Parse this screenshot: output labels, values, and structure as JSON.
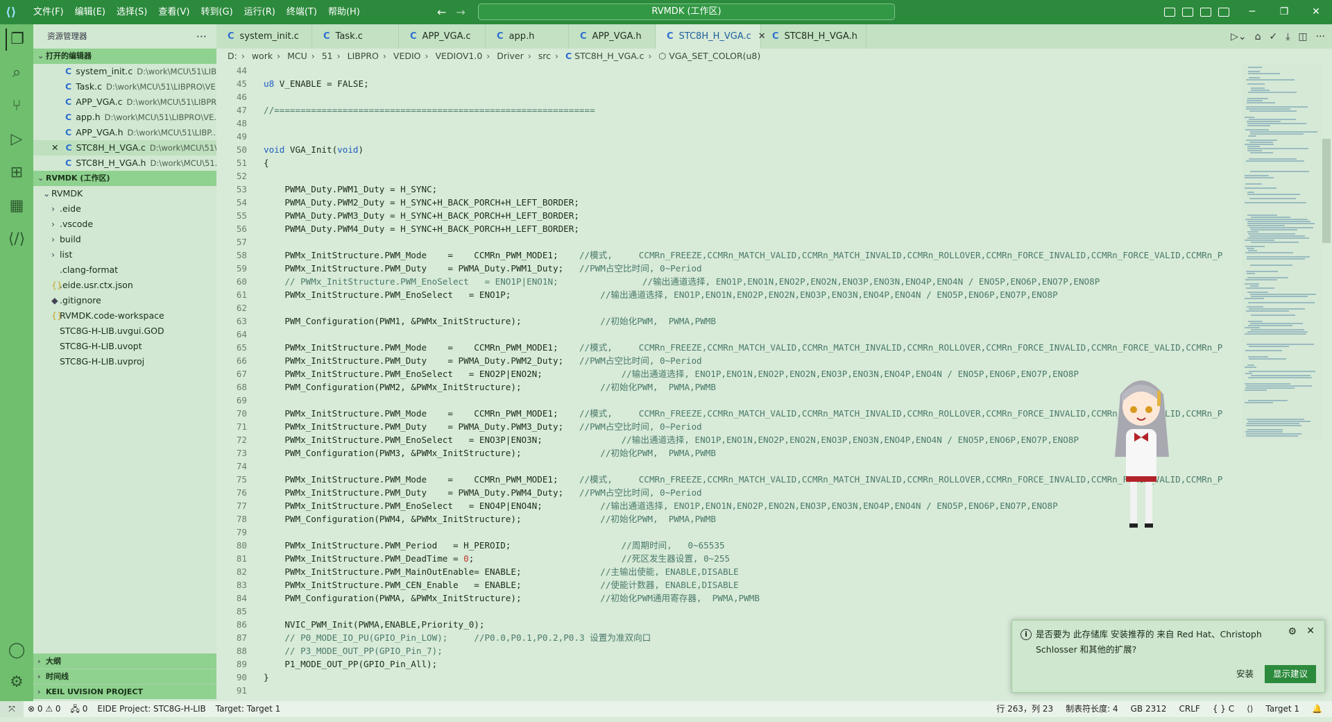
{
  "window": {
    "title": "RVMDK (工作区)"
  },
  "menu": [
    "文件(F)",
    "编辑(E)",
    "选择(S)",
    "查看(V)",
    "转到(G)",
    "运行(R)",
    "终端(T)",
    "帮助(H)"
  ],
  "sidebar": {
    "title": "资源管理器",
    "more": "···",
    "open_editors_title": "打开的编辑器",
    "open_editors": [
      {
        "name": "system_init.c",
        "path": "D:\\work\\MCU\\51\\LIB..."
      },
      {
        "name": "Task.c",
        "path": "D:\\work\\MCU\\51\\LIBPRO\\VE..."
      },
      {
        "name": "APP_VGA.c",
        "path": "D:\\work\\MCU\\51\\LIBPR..."
      },
      {
        "name": "app.h",
        "path": "D:\\work\\MCU\\51\\LIBPRO\\VE..."
      },
      {
        "name": "APP_VGA.h",
        "path": "D:\\work\\MCU\\51\\LIBP..."
      },
      {
        "name": "STC8H_H_VGA.c",
        "path": "D:\\work\\MCU\\51\\..."
      },
      {
        "name": "STC8H_H_VGA.h",
        "path": "D:\\work\\MCU\\51..."
      }
    ],
    "workspace_title": "RVMDK (工作区)",
    "root": "RVMDK",
    "folders": [
      ".eide",
      ".vscode",
      "build",
      "list"
    ],
    "files": [
      {
        "name": ".clang-format",
        "icon": ""
      },
      {
        "name": ".eide.usr.ctx.json",
        "icon": "{}"
      },
      {
        "name": ".gitignore",
        "icon": "◆"
      },
      {
        "name": "RVMDK.code-workspace",
        "icon": "{}"
      },
      {
        "name": "STC8G-H-LIB.uvgui.GOD",
        "icon": ""
      },
      {
        "name": "STC8G-H-LIB.uvopt",
        "icon": ""
      },
      {
        "name": "STC8G-H-LIB.uvproj",
        "icon": ""
      }
    ],
    "bottom_sections": [
      "大纲",
      "时间线",
      "KEIL UVISION PROJECT"
    ]
  },
  "tabs": [
    "system_init.c",
    "Task.c",
    "APP_VGA.c",
    "app.h",
    "APP_VGA.h",
    "STC8H_H_VGA.c",
    "STC8H_H_VGA.h"
  ],
  "active_tab": "STC8H_H_VGA.c",
  "breadcrumb": [
    "D:",
    "work",
    "MCU",
    "51",
    "LIBPRO",
    "VEDIO",
    "VEDIOV1.0",
    "Driver",
    "src",
    "STC8H_H_VGA.c",
    "VGA_SET_COLOR(u8)"
  ],
  "code": [
    {
      "n": "44",
      "t": ""
    },
    {
      "n": "45",
      "t": "<span class='kw'>u8</span> V_ENABLE = FALSE;"
    },
    {
      "n": "46",
      "t": ""
    },
    {
      "n": "47",
      "t": "<span class='cm'>//=============================================================</span>"
    },
    {
      "n": "48",
      "t": ""
    },
    {
      "n": "49",
      "t": ""
    },
    {
      "n": "50",
      "t": "<span class='kw'>void</span> VGA_Init(<span class='kw'>void</span>)"
    },
    {
      "n": "51",
      "t": "{"
    },
    {
      "n": "52",
      "t": ""
    },
    {
      "n": "53",
      "t": "    PWMA_Duty.PWM1_Duty = H_SYNC;"
    },
    {
      "n": "54",
      "t": "    PWMA_Duty.PWM2_Duty = H_SYNC+H_BACK_PORCH+H_LEFT_BORDER;"
    },
    {
      "n": "55",
      "t": "    PWMA_Duty.PWM3_Duty = H_SYNC+H_BACK_PORCH+H_LEFT_BORDER;"
    },
    {
      "n": "56",
      "t": "    PWMA_Duty.PWM4_Duty = H_SYNC+H_BACK_PORCH+H_LEFT_BORDER;"
    },
    {
      "n": "57",
      "t": ""
    },
    {
      "n": "58",
      "t": "    PWMx_InitStructure.PWM_Mode    =    CCMRn_PWM_MODE1;    <span class='cm'>//模式,     CCMRn_FREEZE,CCMRn_MATCH_VALID,CCMRn_MATCH_INVALID,CCMRn_ROLLOVER,CCMRn_FORCE_INVALID,CCMRn_FORCE_VALID,CCMRn_P</span>"
    },
    {
      "n": "59",
      "t": "    PWMx_InitStructure.PWM_Duty    = PWMA_Duty.PWM1_Duty;   <span class='cm'>//PWM占空比时间, 0~Period</span>"
    },
    {
      "n": "60",
      "t": "    <span class='cm'>// PWMx_InitStructure.PWM_EnoSelect   = ENO1P|ENO1N;                //输出通道选择, ENO1P,ENO1N,ENO2P,ENO2N,ENO3P,ENO3N,ENO4P,ENO4N / ENO5P,ENO6P,ENO7P,ENO8P</span>"
    },
    {
      "n": "61",
      "t": "    PWMx_InitStructure.PWM_EnoSelect   = ENO1P;                 <span class='cm'>//输出通道选择, ENO1P,ENO1N,ENO2P,ENO2N,ENO3P,ENO3N,ENO4P,ENO4N / ENO5P,ENO6P,ENO7P,ENO8P</span>"
    },
    {
      "n": "62",
      "t": ""
    },
    {
      "n": "63",
      "t": "    PWM_Configuration(PWM1, &PWMx_InitStructure);               <span class='cm'>//初始化PWM,  PWMA,PWMB</span>"
    },
    {
      "n": "64",
      "t": ""
    },
    {
      "n": "65",
      "t": "    PWMx_InitStructure.PWM_Mode    =    CCMRn_PWM_MODE1;    <span class='cm'>//模式,     CCMRn_FREEZE,CCMRn_MATCH_VALID,CCMRn_MATCH_INVALID,CCMRn_ROLLOVER,CCMRn_FORCE_INVALID,CCMRn_FORCE_VALID,CCMRn_P</span>"
    },
    {
      "n": "66",
      "t": "    PWMx_InitStructure.PWM_Duty    = PWMA_Duty.PWM2_Duty;   <span class='cm'>//PWM占空比时间, 0~Period</span>"
    },
    {
      "n": "67",
      "t": "    PWMx_InitStructure.PWM_EnoSelect   = ENO2P|ENO2N;               <span class='cm'>//输出通道选择, ENO1P,ENO1N,ENO2P,ENO2N,ENO3P,ENO3N,ENO4P,ENO4N / ENO5P,ENO6P,ENO7P,ENO8P</span>"
    },
    {
      "n": "68",
      "t": "    PWM_Configuration(PWM2, &PWMx_InitStructure);               <span class='cm'>//初始化PWM,  PWMA,PWMB</span>"
    },
    {
      "n": "69",
      "t": ""
    },
    {
      "n": "70",
      "t": "    PWMx_InitStructure.PWM_Mode    =    CCMRn_PWM_MODE1;    <span class='cm'>//模式,     CCMRn_FREEZE,CCMRn_MATCH_VALID,CCMRn_MATCH_INVALID,CCMRn_ROLLOVER,CCMRn_FORCE_INVALID,CCMRn_FORCE_VALID,CCMRn_P</span>"
    },
    {
      "n": "71",
      "t": "    PWMx_InitStructure.PWM_Duty    = PWMA_Duty.PWM3_Duty;   <span class='cm'>//PWM占空比时间, 0~Period</span>"
    },
    {
      "n": "72",
      "t": "    PWMx_InitStructure.PWM_EnoSelect   = ENO3P|ENO3N;               <span class='cm'>//输出通道选择, ENO1P,ENO1N,ENO2P,ENO2N,ENO3P,ENO3N,ENO4P,ENO4N / ENO5P,ENO6P,ENO7P,ENO8P</span>"
    },
    {
      "n": "73",
      "t": "    PWM_Configuration(PWM3, &PWMx_InitStructure);               <span class='cm'>//初始化PWM,  PWMA,PWMB</span>"
    },
    {
      "n": "74",
      "t": ""
    },
    {
      "n": "75",
      "t": "    PWMx_InitStructure.PWM_Mode    =    CCMRn_PWM_MODE1;    <span class='cm'>//模式,     CCMRn_FREEZE,CCMRn_MATCH_VALID,CCMRn_MATCH_INVALID,CCMRn_ROLLOVER,CCMRn_FORCE_INVALID,CCMRn_FORCE_VALID,CCMRn_P</span>"
    },
    {
      "n": "76",
      "t": "    PWMx_InitStructure.PWM_Duty    = PWMA_Duty.PWM4_Duty;   <span class='cm'>//PWM占空比时间, 0~Period</span>"
    },
    {
      "n": "77",
      "t": "    PWMx_InitStructure.PWM_EnoSelect   = ENO4P|ENO4N;           <span class='cm'>//输出通道选择, ENO1P,ENO1N,ENO2P,ENO2N,ENO3P,ENO3N,ENO4P,ENO4N / ENO5P,ENO6P,ENO7P,ENO8P</span>"
    },
    {
      "n": "78",
      "t": "    PWM_Configuration(PWM4, &PWMx_InitStructure);               <span class='cm'>//初始化PWM,  PWMA,PWMB</span>"
    },
    {
      "n": "79",
      "t": ""
    },
    {
      "n": "80",
      "t": "    PWMx_InitStructure.PWM_Period   = H_PEROID;                     <span class='cm'>//周期时间,   0~65535</span>"
    },
    {
      "n": "81",
      "t": "    PWMx_InitStructure.PWM_DeadTime = <span class='nu'>0</span>;                            <span class='cm'>//死区发生器设置, 0~255</span>"
    },
    {
      "n": "82",
      "t": "    PWMx_InitStructure.PWM_MainOutEnable= ENABLE;               <span class='cm'>//主输出使能, ENABLE,DISABLE</span>"
    },
    {
      "n": "83",
      "t": "    PWMx_InitStructure.PWM_CEN_Enable   = ENABLE;               <span class='cm'>//使能计数器, ENABLE,DISABLE</span>"
    },
    {
      "n": "84",
      "t": "    PWM_Configuration(PWMA, &PWMx_InitStructure);               <span class='cm'>//初始化PWM通用寄存器,  PWMA,PWMB</span>"
    },
    {
      "n": "85",
      "t": ""
    },
    {
      "n": "86",
      "t": "    NVIC_PWM_Init(PWMA,ENABLE,Priority_0);"
    },
    {
      "n": "87",
      "t": "    <span class='cm'>// P0_MODE_IO_PU(GPIO_Pin_LOW);     //P0.0,P0.1,P0.2,P0.3 设置为准双向口</span>"
    },
    {
      "n": "88",
      "t": "    <span class='cm'>// P3_MODE_OUT_PP(GPIO_Pin_7);</span>"
    },
    {
      "n": "89",
      "t": "    P1_MODE_OUT_PP(GPIO_Pin_All);"
    },
    {
      "n": "90",
      "t": "}"
    },
    {
      "n": "91",
      "t": ""
    }
  ],
  "notification": {
    "message": "是否要为 此存储库 安装推荐的 来自 Red Hat、Christoph Schlosser 和其他的扩展?",
    "install": "安装",
    "show": "显示建议"
  },
  "status": {
    "errors": "⊗ 0 ⚠ 0",
    "ports": "🖧 0",
    "project": "EIDE Project: STC8G-H-LIB",
    "target": "Target: Target 1",
    "position": "行 263，列 23",
    "tabsize": "制表符长度: 4",
    "encoding": "GB 2312",
    "eol": "CRLF",
    "lang": "{ } C",
    "target_right": "Target 1"
  },
  "colors": {
    "titlebar": "#2c8a3c",
    "activity": "#6fbf6f",
    "sidebar": "#d2e8d2",
    "editor": "#d8ead8"
  }
}
